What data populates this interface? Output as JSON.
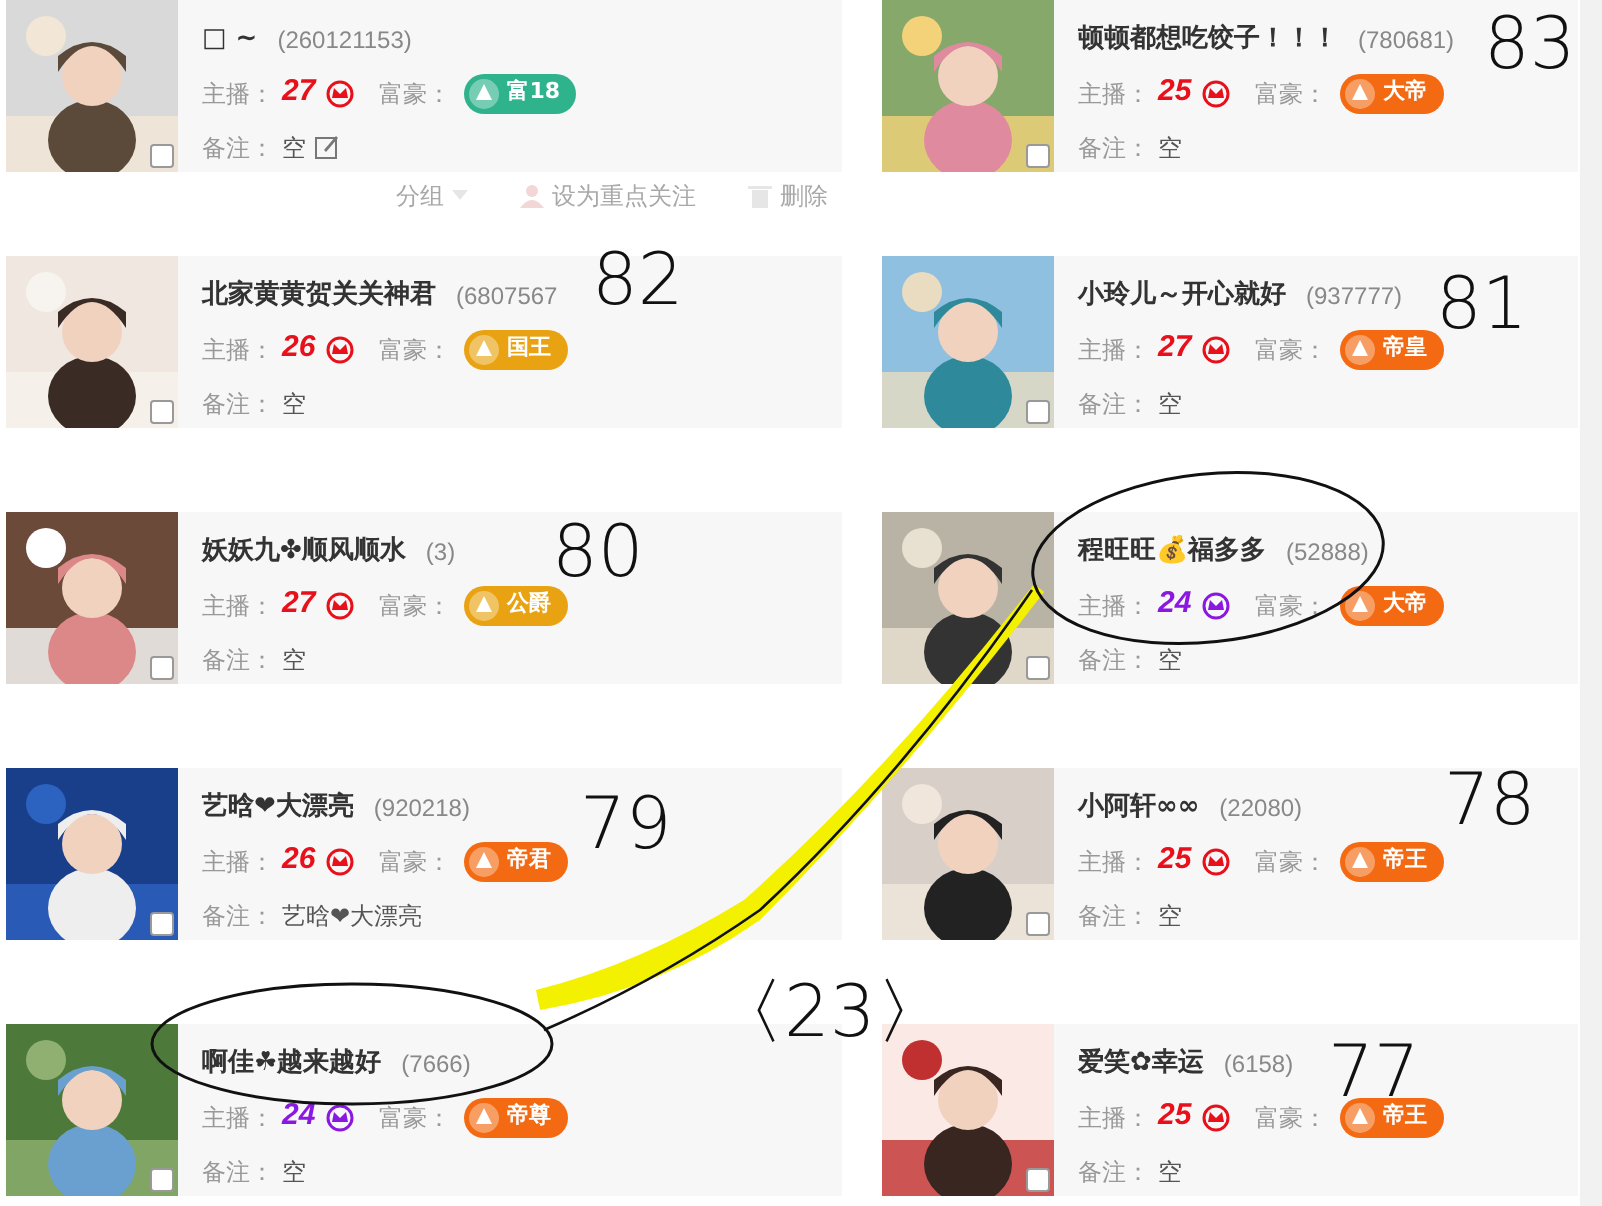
{
  "cards": [
    {
      "name": "□ ~",
      "id": "(260121153)",
      "host_label": "主播：",
      "host_level": "27",
      "color": "#e8101a",
      "rich_label": "富豪：",
      "badge": {
        "label": "富18",
        "color": "#2fb38c"
      },
      "remark_label": "备注：",
      "remark": "空",
      "editable": true,
      "checked": false
    },
    {
      "name": "顿顿都想吃饺子！！！",
      "id": "(780681)",
      "host_label": "主播：",
      "host_level": "25",
      "color": "#e8101a",
      "rich_label": "富豪：",
      "badge": {
        "label": "大帝",
        "color": "#f36a12"
      },
      "remark_label": "备注：",
      "remark": "空",
      "editable": false,
      "checked": false
    },
    {
      "name": "北家黄黄贺关关神君",
      "id": "(6807567",
      "host_label": "主播：",
      "host_level": "26",
      "color": "#e8101a",
      "rich_label": "富豪：",
      "badge": {
        "label": "国王",
        "color": "#e9a312"
      },
      "remark_label": "备注：",
      "remark": "空",
      "editable": false,
      "checked": false
    },
    {
      "name": "小玲儿～开心就好",
      "id": "(937777)",
      "host_label": "主播：",
      "host_level": "27",
      "color": "#e8101a",
      "rich_label": "富豪：",
      "badge": {
        "label": "帝皇",
        "color": "#f36a12"
      },
      "remark_label": "备注：",
      "remark": "空",
      "editable": false,
      "checked": false
    },
    {
      "name": "妖妖九✤顺风顺水",
      "id": "(3)",
      "host_label": "主播：",
      "host_level": "27",
      "color": "#e8101a",
      "rich_label": "富豪：",
      "badge": {
        "label": "公爵",
        "color": "#e9a312"
      },
      "remark_label": "备注：",
      "remark": "空",
      "editable": false,
      "checked": false
    },
    {
      "name": "程旺旺💰福多多",
      "id": "(52888)",
      "host_label": "主播：",
      "host_level": "24",
      "color": "#8b18e0",
      "rich_label": "富豪：",
      "badge": {
        "label": "大帝",
        "color": "#f36a12"
      },
      "remark_label": "备注：",
      "remark": "空",
      "editable": false,
      "checked": false
    },
    {
      "name": "艺晗❤大漂亮",
      "id": "(920218)",
      "host_label": "主播：",
      "host_level": "26",
      "color": "#e8101a",
      "rich_label": "富豪：",
      "badge": {
        "label": "帝君",
        "color": "#f36a12"
      },
      "remark_label": "备注：",
      "remark": "艺晗❤大漂亮",
      "editable": false,
      "checked": false
    },
    {
      "name": "小阿轩∞∞",
      "id": "(22080)",
      "host_label": "主播：",
      "host_level": "25",
      "color": "#e8101a",
      "rich_label": "富豪：",
      "badge": {
        "label": "帝王",
        "color": "#f36a12"
      },
      "remark_label": "备注：",
      "remark": "空",
      "editable": false,
      "checked": false
    },
    {
      "name": "啊佳☘越来越好",
      "id": "(7666)",
      "host_label": "主播：",
      "host_level": "24",
      "color": "#8b18e0",
      "rich_label": "富豪：",
      "badge": {
        "label": "帝尊",
        "color": "#f36a12"
      },
      "remark_label": "备注：",
      "remark": "空",
      "editable": false,
      "checked": false
    },
    {
      "name": "爱笑✿幸运",
      "id": "(6158)",
      "host_label": "主播：",
      "host_level": "25",
      "color": "#e8101a",
      "rich_label": "富豪：",
      "badge": {
        "label": "帝王",
        "color": "#f36a12"
      },
      "remark_label": "备注：",
      "remark": "空",
      "editable": false,
      "checked": false
    }
  ],
  "toolbar": [
    {
      "kind": "group",
      "label": "分组"
    },
    {
      "kind": "follow",
      "label": "设为重点关注"
    },
    {
      "kind": "delete",
      "label": "删除"
    }
  ],
  "handwriting": [
    "83",
    "82",
    "81",
    "80",
    "79",
    "78",
    "〈23〉",
    "77"
  ]
}
